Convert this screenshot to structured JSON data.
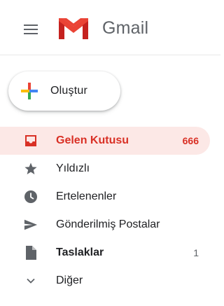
{
  "header": {
    "logo_text": "Gmail"
  },
  "compose": {
    "label": "Oluştur"
  },
  "nav": {
    "items": [
      {
        "label": "Gelen Kutusu",
        "count": "666",
        "icon": "inbox-icon"
      },
      {
        "label": "Yıldızlı",
        "count": "",
        "icon": "star-icon"
      },
      {
        "label": "Ertelenenler",
        "count": "",
        "icon": "clock-icon"
      },
      {
        "label": "Gönderilmiş Postalar",
        "count": "",
        "icon": "send-icon"
      },
      {
        "label": "Taslaklar",
        "count": "1",
        "icon": "draft-icon"
      },
      {
        "label": "Diğer",
        "count": "",
        "icon": "chevron-down-icon"
      }
    ]
  },
  "colors": {
    "active_red": "#d93025",
    "active_bg": "#fce8e6",
    "icon_gray": "#5f6368"
  }
}
